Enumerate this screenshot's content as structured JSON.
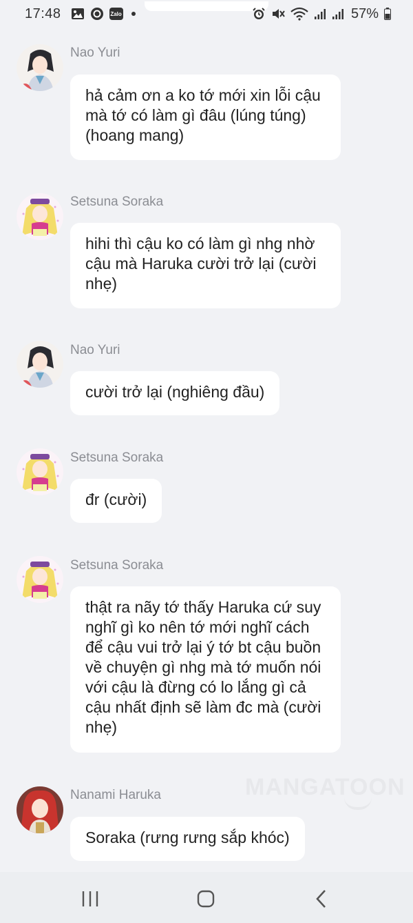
{
  "status_bar": {
    "time": "17:48",
    "battery": "57%",
    "left_icons": [
      "image-icon",
      "messenger-icon",
      "zalo-icon",
      "notification-dot-icon"
    ],
    "zalo_label": "Zalo",
    "right_icons": [
      "alarm-icon",
      "mute-icon",
      "wifi-icon",
      "signal-icon",
      "signal-icon",
      "battery-icon"
    ]
  },
  "messages": [
    {
      "sender": "Nao Yuri",
      "text": "hả cảm ơn a ko tớ mới xin lỗi cậu mà tớ có làm gì đâu (lúng túng) (hoang mang)"
    },
    {
      "sender": "Setsuna Soraka",
      "text": "hihi thì cậu ko có làm gì nhg nhờ cậu mà Haruka cười trở lại (cười nhẹ)"
    },
    {
      "sender": "Nao Yuri",
      "text": "cười trở lại (nghiêng đầu)"
    },
    {
      "sender": "Setsuna Soraka",
      "text": "đr (cười)"
    },
    {
      "sender": "Setsuna Soraka",
      "text": "thật ra nãy tớ thấy Haruka cứ suy nghĩ gì ko nên tớ mới nghĩ cách để cậu vui trở lại ý tớ bt cậu buồn về chuyện gì nhg mà tớ muốn nói với cậu là đừng có lo lắng gì cả cậu nhất định sẽ làm đc mà (cười nhẹ)"
    },
    {
      "sender": "Nanami Haruka",
      "text": "Soraka (rưng rưng sắp khóc)"
    }
  ],
  "watermark": "MANGATOON",
  "nav": {
    "icons": [
      "recent-apps-icon",
      "home-icon",
      "back-icon"
    ]
  },
  "colors": {
    "background": "#f1f2f5",
    "bubble": "#ffffff",
    "sender_name": "#8b8d93",
    "text": "#222222"
  }
}
